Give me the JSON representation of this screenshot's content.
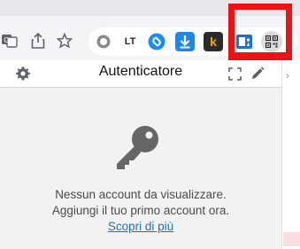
{
  "popup": {
    "title": "Autenticatore",
    "empty_message_line1": "Nessun account da visualizzare.",
    "empty_message_line2": "Aggiungi il tuo primo account ora.",
    "learn_more_link": "Scopri di più"
  },
  "toolbar": {
    "icons": [
      "translate-icon",
      "share-icon",
      "bookmark-star-icon"
    ],
    "extensions": [
      "circle-extension-icon",
      "languagetool-extension-icon",
      "shazam-extension-icon",
      "download-extension-icon",
      "keepa-extension-icon",
      "screen-reader-extension-icon",
      "authenticator-extension-icon"
    ],
    "languagetool_label": "LT",
    "keepa_label": "k"
  },
  "colors": {
    "highlight": "#f01212",
    "link": "#1a73b8",
    "shazam": "#1c8ef2",
    "download": "#1e88e5",
    "keepa": "#f2a900"
  }
}
